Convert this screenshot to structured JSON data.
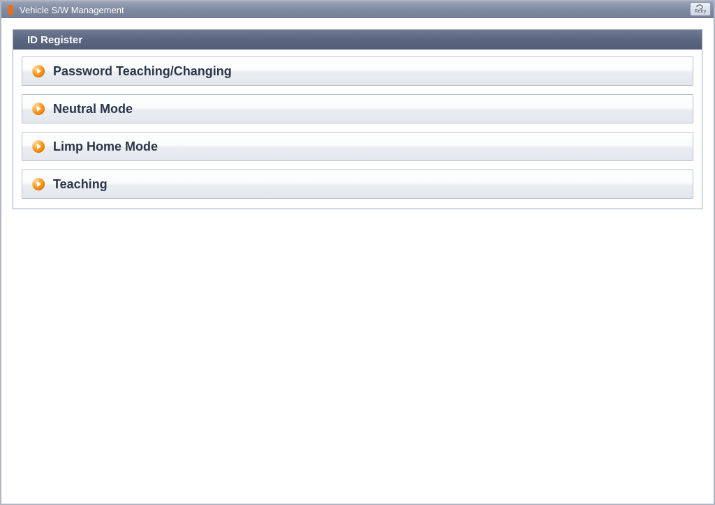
{
  "window": {
    "title": "Vehicle S/W Management",
    "retry_label": "Retry"
  },
  "panel": {
    "header": "ID Register",
    "items": [
      {
        "label": "Password Teaching/Changing"
      },
      {
        "label": "Neutral Mode"
      },
      {
        "label": "Limp Home Mode"
      },
      {
        "label": "Teaching"
      }
    ]
  }
}
